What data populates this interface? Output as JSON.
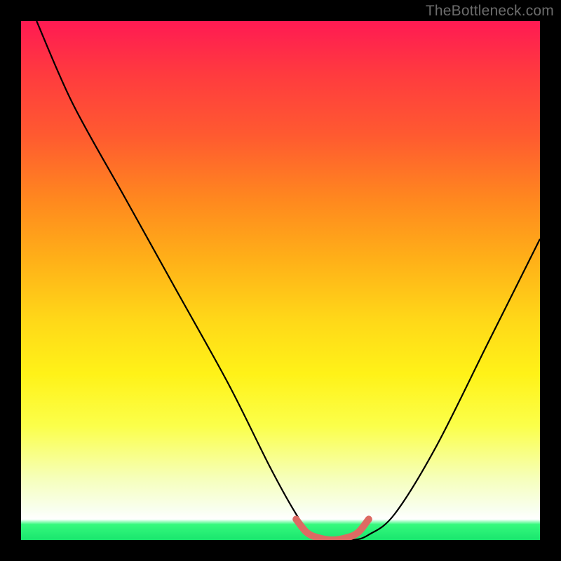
{
  "watermark": "TheBottleneck.com",
  "colors": {
    "frame": "#000000",
    "curve": "#000000",
    "highlight": "#dd6a63",
    "gradient_top": "#ff1a53",
    "gradient_bottom": "#19e66e"
  },
  "chart_data": {
    "type": "line",
    "title": "",
    "xlabel": "",
    "ylabel": "",
    "xlim": [
      0,
      100
    ],
    "ylim": [
      0,
      100
    ],
    "grid": false,
    "series": [
      {
        "name": "bottleneck-curve",
        "x": [
          3,
          10,
          20,
          30,
          40,
          48,
          53,
          56,
          60,
          64,
          67,
          72,
          80,
          90,
          100
        ],
        "y": [
          100,
          84,
          66,
          48,
          30,
          14,
          5,
          1,
          0,
          0,
          1,
          5,
          18,
          38,
          58
        ]
      }
    ],
    "highlight_segment": {
      "name": "minimum-plateau",
      "x": [
        53,
        55,
        57,
        60,
        63,
        65,
        67
      ],
      "y": [
        4,
        1.5,
        0.5,
        0,
        0.5,
        1.5,
        4
      ]
    }
  }
}
